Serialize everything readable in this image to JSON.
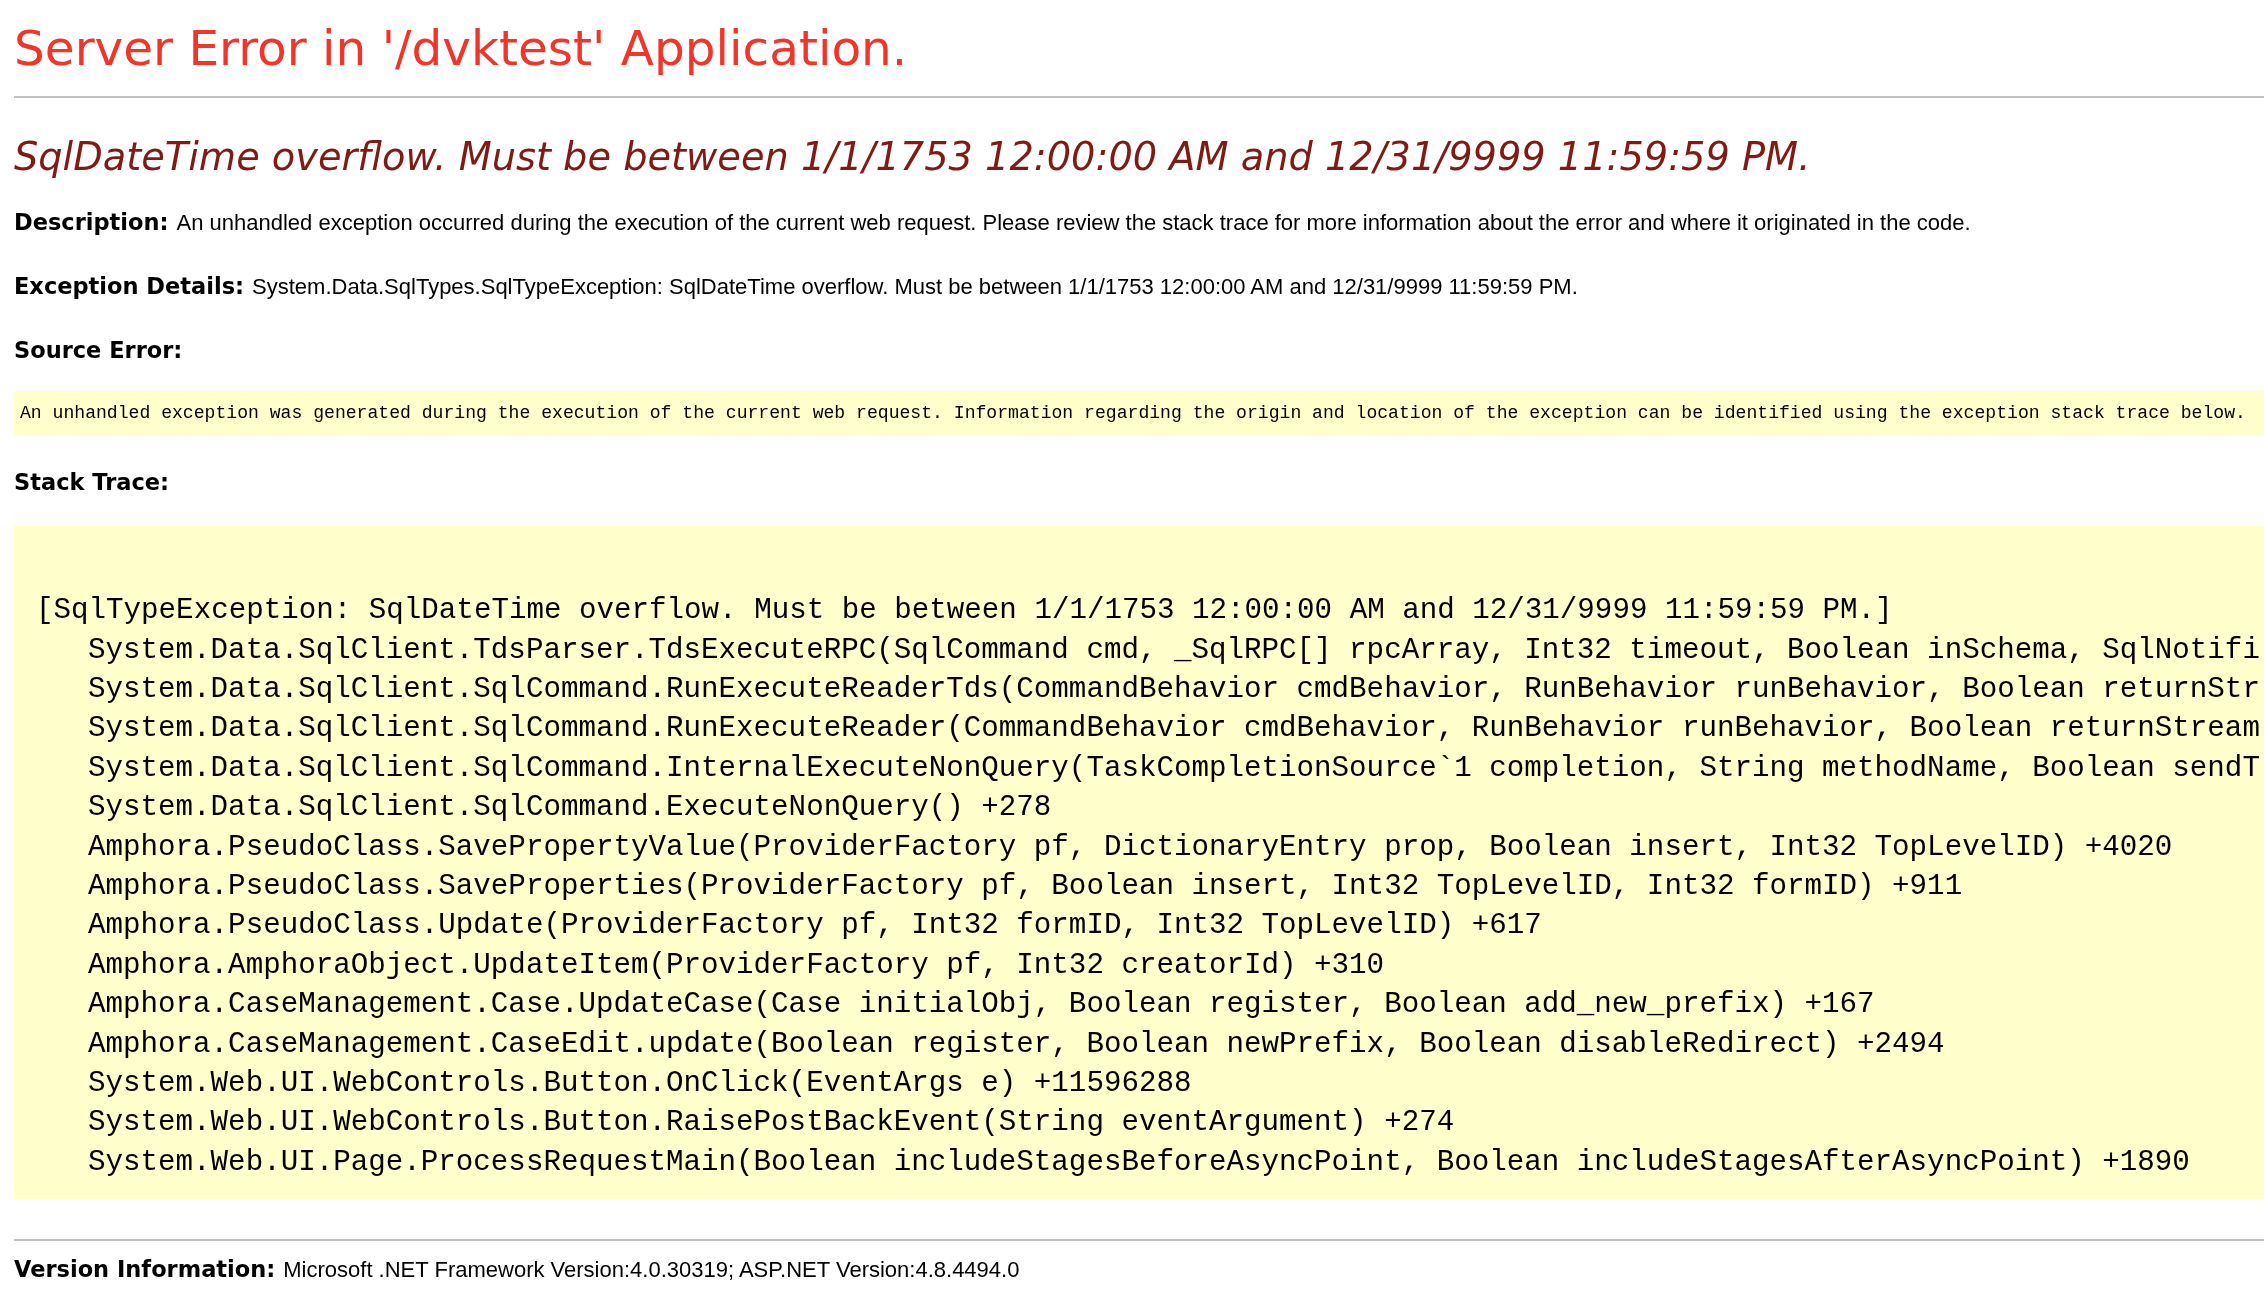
{
  "title": "Server Error in '/dvktest' Application.",
  "subtitle": "SqlDateTime overflow. Must be between 1/1/1753 12:00:00 AM and 12/31/9999 11:59:59 PM.",
  "description": {
    "label": "Description:",
    "text": "An unhandled exception occurred during the execution of the current web request. Please review the stack trace for more information about the error and where it originated in the code."
  },
  "exception_details": {
    "label": "Exception Details:",
    "text": "System.Data.SqlTypes.SqlTypeException: SqlDateTime overflow. Must be between 1/1/1753 12:00:00 AM and 12/31/9999 11:59:59 PM."
  },
  "source_error": {
    "label": "Source Error:",
    "text": "An unhandled exception was generated during the execution of the current web request. Information regarding the origin and location of the exception can be identified using the exception stack trace below."
  },
  "stack_trace": {
    "label": "Stack Trace:",
    "lines": [
      {
        "kind": "header",
        "text": "[SqlTypeException: SqlDateTime overflow. Must be between 1/1/1753 12:00:00 AM and 12/31/9999 11:59:59 PM.]"
      },
      {
        "kind": "frame",
        "text": "System.Data.SqlClient.TdsParser.TdsExecuteRPC(SqlCommand cmd, _SqlRPC[] rpcArray, Int32 timeout, Boolean inSchema, SqlNotifi"
      },
      {
        "kind": "frame",
        "text": "System.Data.SqlClient.SqlCommand.RunExecuteReaderTds(CommandBehavior cmdBehavior, RunBehavior runBehavior, Boolean returnStr"
      },
      {
        "kind": "frame",
        "text": "System.Data.SqlClient.SqlCommand.RunExecuteReader(CommandBehavior cmdBehavior, RunBehavior runBehavior, Boolean returnStream"
      },
      {
        "kind": "frame",
        "text": "System.Data.SqlClient.SqlCommand.InternalExecuteNonQuery(TaskCompletionSource`1 completion, String methodName, Boolean sendT"
      },
      {
        "kind": "frame",
        "text": "System.Data.SqlClient.SqlCommand.ExecuteNonQuery() +278"
      },
      {
        "kind": "frame",
        "text": "Amphora.PseudoClass.SavePropertyValue(ProviderFactory pf, DictionaryEntry prop, Boolean insert, Int32 TopLevelID) +4020"
      },
      {
        "kind": "frame",
        "text": "Amphora.PseudoClass.SaveProperties(ProviderFactory pf, Boolean insert, Int32 TopLevelID, Int32 formID) +911"
      },
      {
        "kind": "frame",
        "text": "Amphora.PseudoClass.Update(ProviderFactory pf, Int32 formID, Int32 TopLevelID) +617"
      },
      {
        "kind": "frame",
        "text": "Amphora.AmphoraObject.UpdateItem(ProviderFactory pf, Int32 creatorId) +310"
      },
      {
        "kind": "frame",
        "text": "Amphora.CaseManagement.Case.UpdateCase(Case initialObj, Boolean register, Boolean add_new_prefix) +167"
      },
      {
        "kind": "frame",
        "text": "Amphora.CaseManagement.CaseEdit.update(Boolean register, Boolean newPrefix, Boolean disableRedirect) +2494"
      },
      {
        "kind": "frame",
        "text": "System.Web.UI.WebControls.Button.OnClick(EventArgs e) +11596288"
      },
      {
        "kind": "frame",
        "text": "System.Web.UI.WebControls.Button.RaisePostBackEvent(String eventArgument) +274"
      },
      {
        "kind": "frame",
        "text": "System.Web.UI.Page.ProcessRequestMain(Boolean includeStagesBeforeAsyncPoint, Boolean includeStagesAfterAsyncPoint) +1890"
      }
    ]
  },
  "version_info": {
    "label": "Version Information:",
    "text": "Microsoft .NET Framework Version:4.0.30319; ASP.NET Version:4.8.4494.0"
  }
}
